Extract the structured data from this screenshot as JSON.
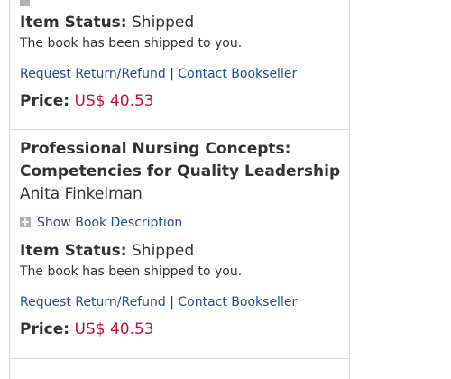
{
  "orders": [
    {
      "status_label": "Item Status:",
      "status_value": "Shipped",
      "status_description": "The book has been shipped to you.",
      "request_return_label": "Request Return/Refund",
      "separator": "|",
      "contact_label": "Contact Bookseller",
      "price_label": "Price:",
      "price_value": "US$ 40.53"
    },
    {
      "title_line1": "Professional Nursing Concepts:",
      "title_line2": "Competencies for Quality Leadership",
      "author": "Anita Finkelman",
      "show_description_label": "Show Book Description",
      "status_label": "Item Status:",
      "status_value": "Shipped",
      "status_description": "The book has been shipped to you.",
      "request_return_label": "Request Return/Refund",
      "separator": "|",
      "contact_label": "Contact Bookseller",
      "price_label": "Price:",
      "price_value": "US$ 40.53"
    }
  ],
  "colors": {
    "link": "#1f4e9a",
    "price": "#c8102e",
    "border": "#dcdcdc",
    "icon": "#a9b4bf"
  }
}
